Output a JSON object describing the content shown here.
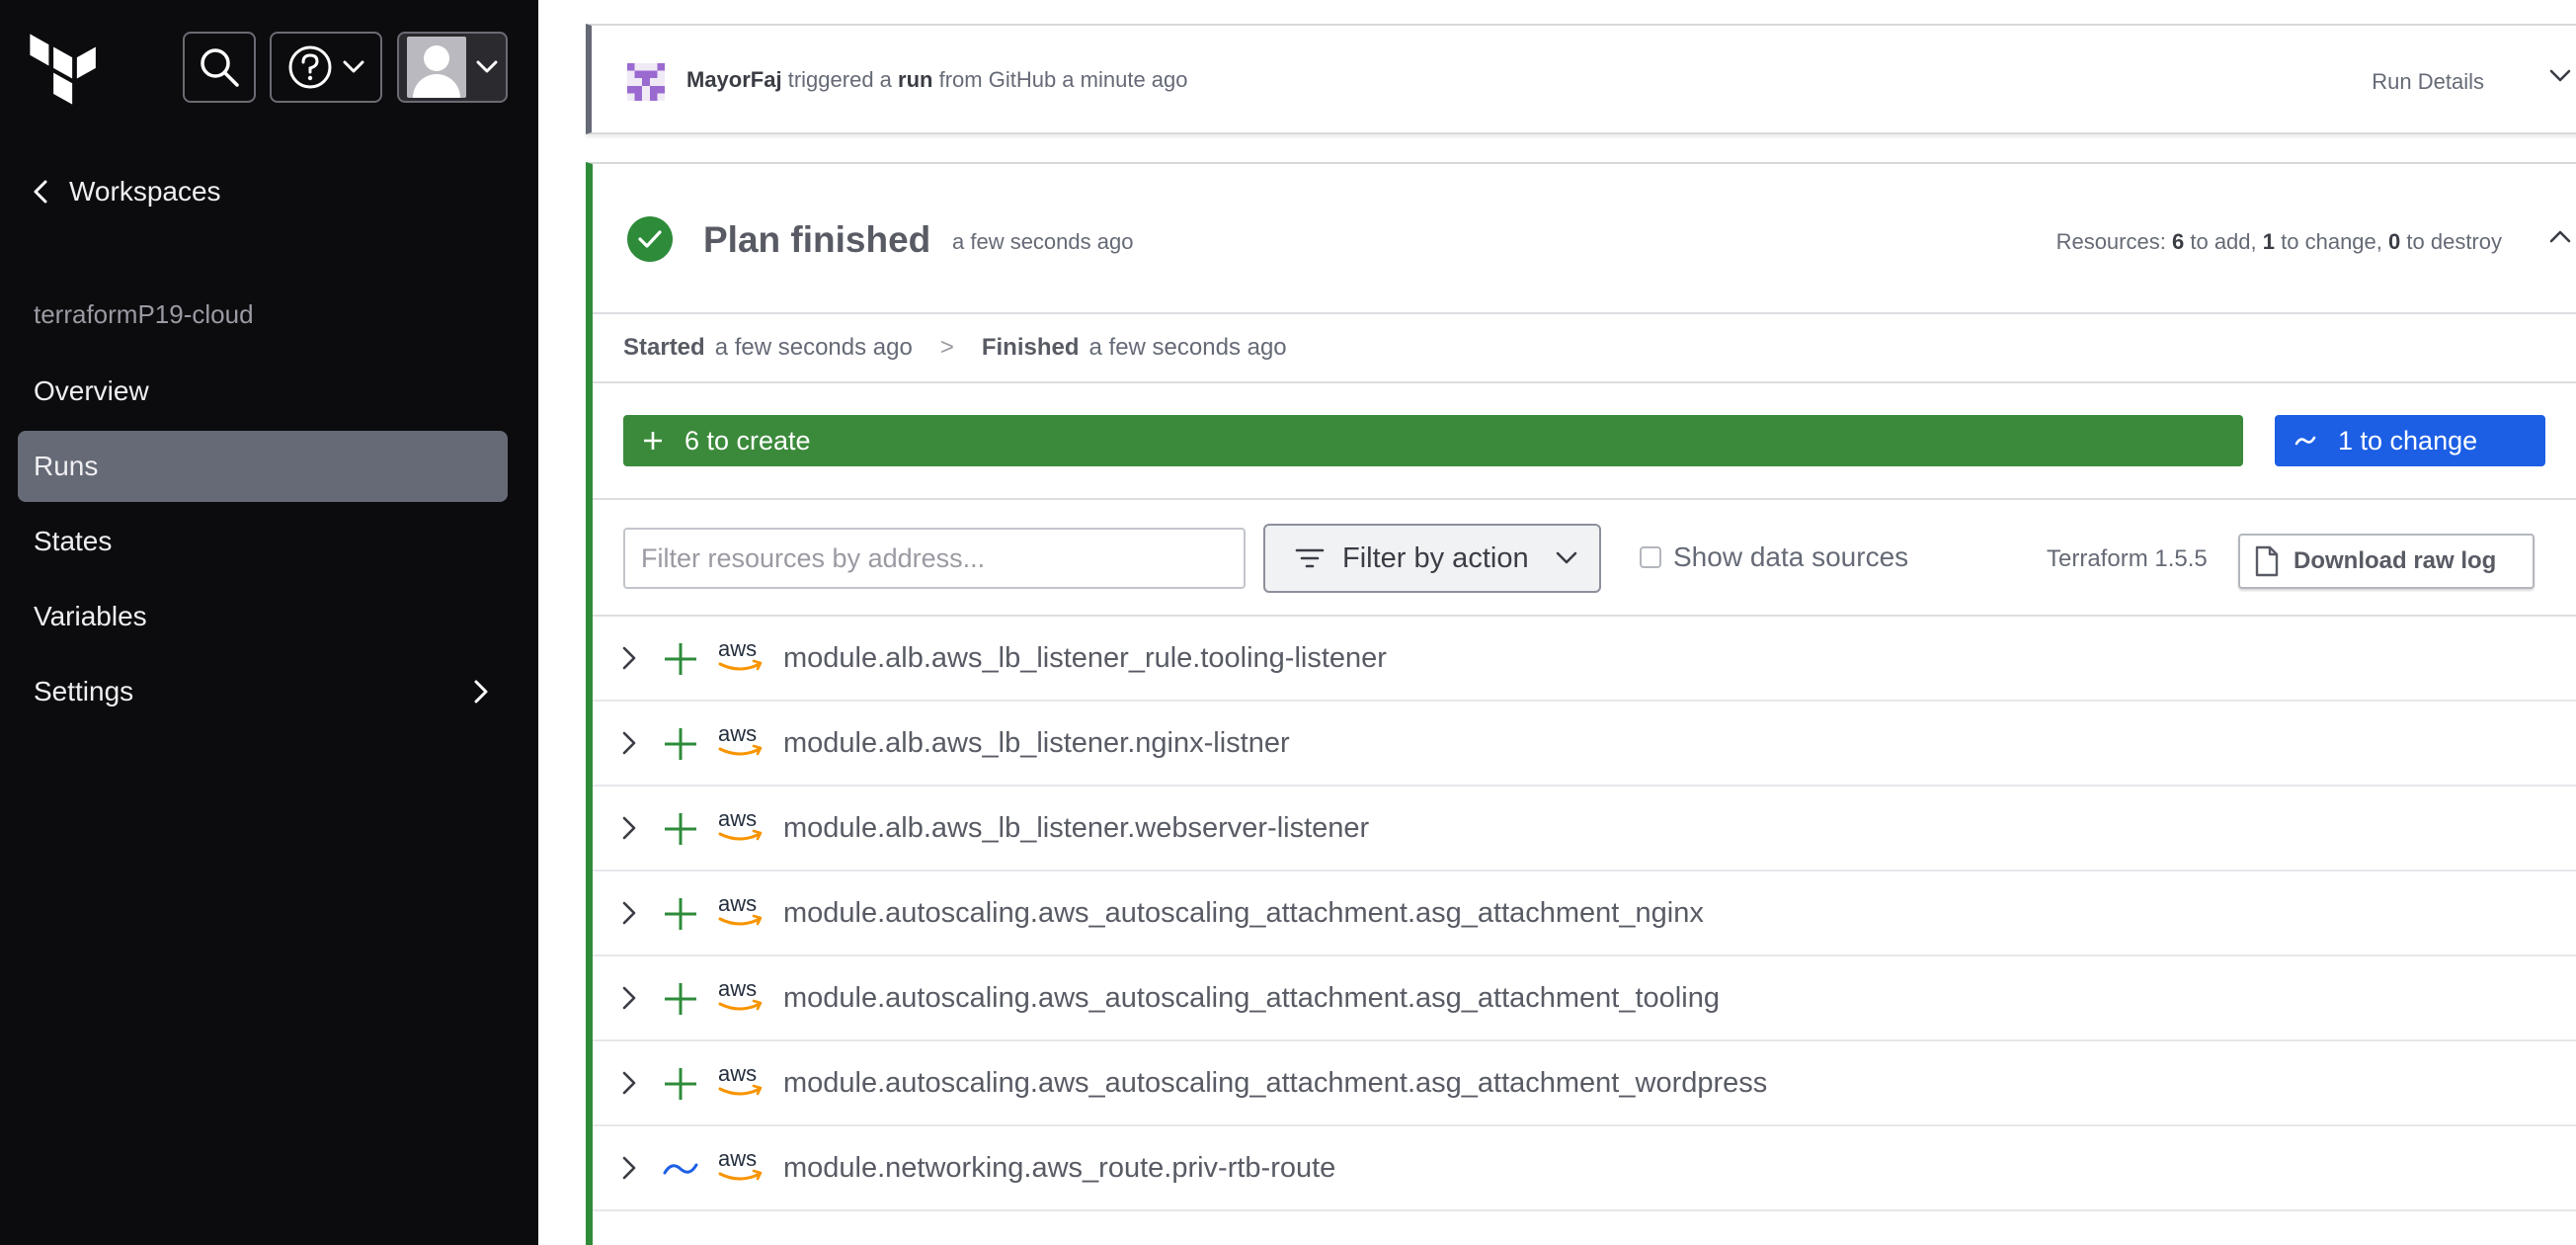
{
  "sidebar": {
    "back_label": "Workspaces",
    "workspace_name": "terraformP19-cloud",
    "nav": [
      {
        "label": "Overview",
        "active": false
      },
      {
        "label": "Runs",
        "active": true
      },
      {
        "label": "States",
        "active": false
      },
      {
        "label": "Variables",
        "active": false
      },
      {
        "label": "Settings",
        "active": false
      }
    ]
  },
  "run": {
    "user": "MayorFaj",
    "text_triggered": "triggered a",
    "run_word": "run",
    "text_from": "from GitHub a minute ago",
    "details_label": "Run Details"
  },
  "plan": {
    "title": "Plan finished",
    "time": "a few seconds ago",
    "resources_prefix": "Resources:",
    "add_count": "6",
    "add_label": "to add,",
    "change_count": "1",
    "change_label": "to change,",
    "destroy_count": "0",
    "destroy_label": "to destroy",
    "started_label": "Started",
    "started_time": "a few seconds ago",
    "sep": ">",
    "finished_label": "Finished",
    "finished_time": "a few seconds ago",
    "create_bar": "6 to create",
    "change_bar": "1 to change"
  },
  "filters": {
    "placeholder": "Filter resources by address...",
    "action_label": "Filter by action",
    "data_sources_label": "Show data sources",
    "terraform_version": "Terraform 1.5.5",
    "download_label": "Download raw log"
  },
  "resources": [
    {
      "action": "create",
      "address": "module.alb.aws_lb_listener_rule.tooling-listener"
    },
    {
      "action": "create",
      "address": "module.alb.aws_lb_listener.nginx-listner"
    },
    {
      "action": "create",
      "address": "module.alb.aws_lb_listener.webserver-listener"
    },
    {
      "action": "create",
      "address": "module.autoscaling.aws_autoscaling_attachment.asg_attachment_nginx"
    },
    {
      "action": "create",
      "address": "module.autoscaling.aws_autoscaling_attachment.asg_attachment_tooling"
    },
    {
      "action": "create",
      "address": "module.autoscaling.aws_autoscaling_attachment.asg_attachment_wordpress"
    },
    {
      "action": "update",
      "address": "module.networking.aws_route.priv-rtb-route"
    }
  ],
  "colors": {
    "create": "#2e8b3a",
    "update": "#1c5fe5"
  }
}
